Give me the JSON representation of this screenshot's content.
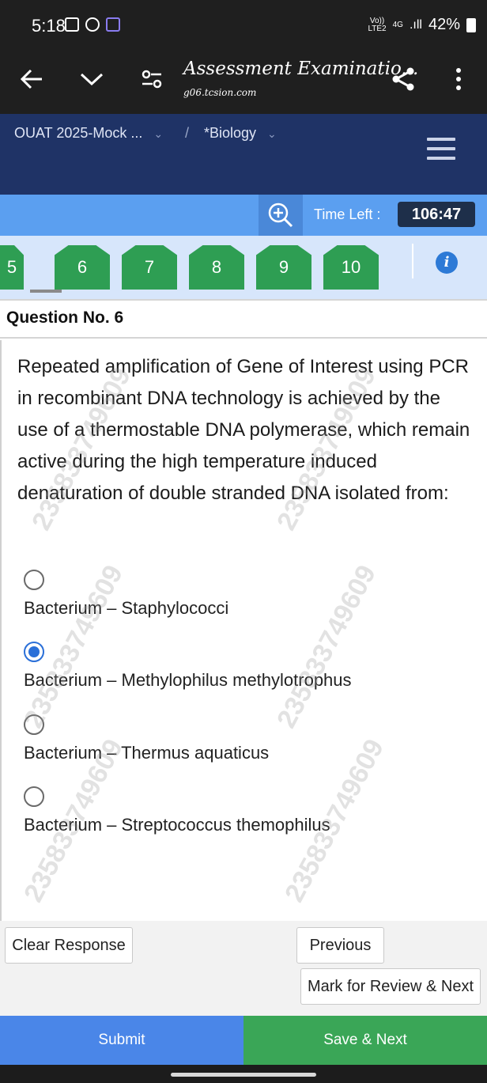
{
  "status": {
    "time": "5:18",
    "net_top": "Vo))",
    "net_bottom": "LTE2",
    "gen": "4G",
    "battery": "42%"
  },
  "toolbar": {
    "title": "Assessment Examinatio...",
    "url": "g06.tcsion.com"
  },
  "breadcrumb": {
    "exam": "OUAT 2025-Mock ...",
    "separator": "/",
    "section": "*Biology"
  },
  "timer": {
    "label": "Time Left :",
    "value": "106:47"
  },
  "question_numbers": [
    "5",
    "6",
    "7",
    "8",
    "9",
    "10"
  ],
  "question": {
    "heading": "Question No. 6",
    "text": "Repeated amplification of Gene of Interest using PCR in recombinant DNA technology is achieved by the use of a thermostable DNA polymerase, which remain active during the high temperature induced denaturation of double stranded DNA isolated from:",
    "options": [
      {
        "label": "Bacterium – Staphylococci",
        "selected": false
      },
      {
        "label": "Bacterium – Methylophilus methylotrophus",
        "selected": true
      },
      {
        "label": "Bacterium – Thermus aquaticus",
        "selected": false
      },
      {
        "label": "Bacterium – Streptococcus themophilus",
        "selected": false
      }
    ]
  },
  "watermark": "235833749609",
  "actions": {
    "clear": "Clear Response",
    "previous": "Previous",
    "review": "Mark for Review & Next",
    "submit": "Submit",
    "save_next": "Save & Next"
  },
  "colors": {
    "nav_bg": "#1f3366",
    "timer_bar": "#5b9ff0",
    "question_button": "#2e9e53",
    "submit": "#4a86e8",
    "save": "#3aa657",
    "radio_selected": "#2a6fd8"
  }
}
